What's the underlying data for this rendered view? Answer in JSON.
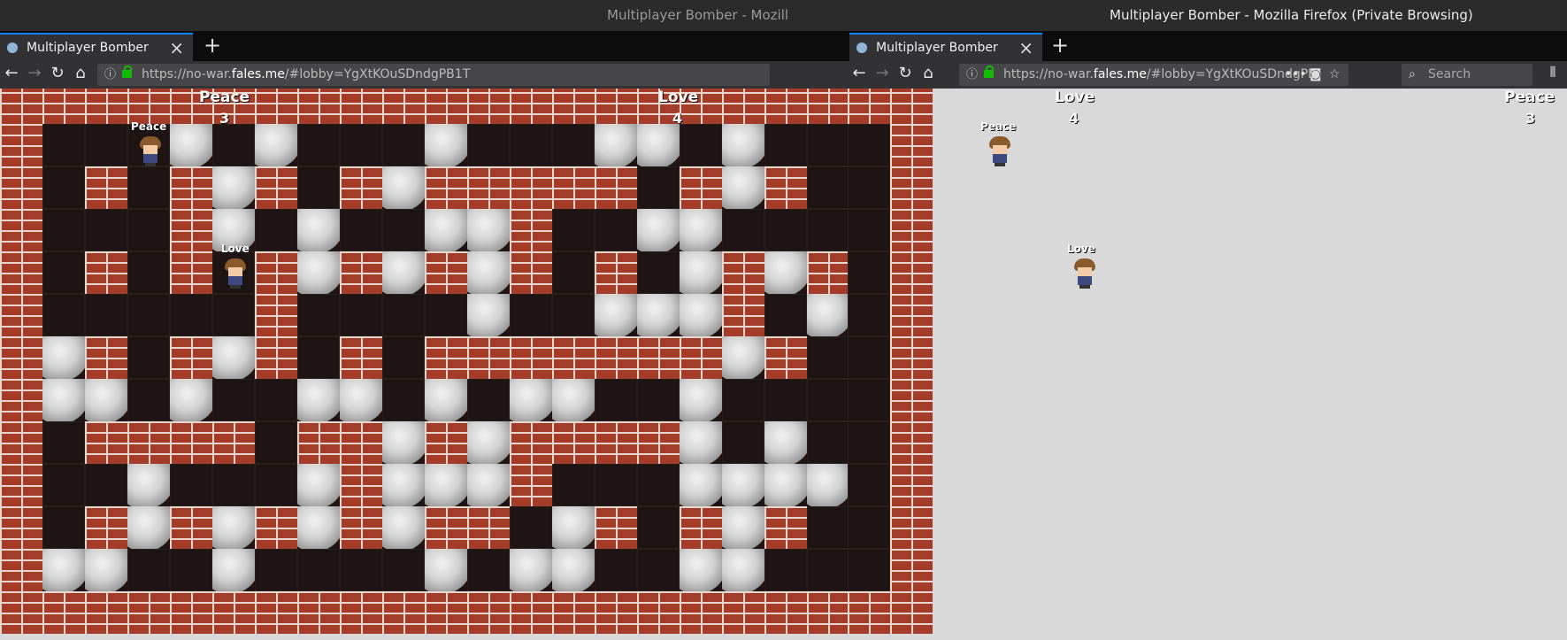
{
  "windows": [
    {
      "id": "left",
      "title": "Multiplayer Bomber - Mozill",
      "tab_label": "Multiplayer Bomber",
      "url_prefix": "https://no-war.",
      "url_host": "fales.me",
      "url_suffix": "/#lobby=YgXtKOuSDndgPB1T",
      "hud": [
        {
          "name": "Peace",
          "score": "3"
        },
        {
          "name": "Love",
          "score": "4"
        }
      ],
      "players": [
        {
          "label": "Peace"
        },
        {
          "label": "Love"
        }
      ]
    },
    {
      "id": "right",
      "title": "Multiplayer Bomber - Mozilla Firefox (Private Browsing)",
      "tab_label": "Multiplayer Bomber",
      "url_prefix": "https://no-war.",
      "url_host": "fales.me",
      "url_suffix": "/#lobby=YgXtKOuSDndgPB",
      "search_placeholder": "Search",
      "hud": [
        {
          "name": "Love",
          "score": "4"
        },
        {
          "name": "Peace",
          "score": "3"
        }
      ],
      "players": [
        {
          "label": "Peace"
        },
        {
          "label": "Love"
        }
      ]
    }
  ],
  "game_board": {
    "legend": {
      "B": "brick-wall",
      "S": "stone-block",
      ".": "floor"
    },
    "rows": [
      "BBBBBBBBBBBBBBBBBBBBBB",
      "BBBBBBBBBBBBBBBBBBBBBB",
      "B...S.S...S...SS.S...B",
      "B.B.BSB.BSBBBBB.BSB..B",
      "B...BS.S..SSB..SS....B",
      "B.B.B.BSBSBSB.B.SBSB.B",
      "B.....B....S..SSSB.S.B",
      "BSB.BSB.B.BBBBBBBSB..B",
      "BSS.S..SS.S.SS..S....B",
      "B.BBBB.BBSBSBBBBS.S..B",
      "B..S...SBSSSB...SSSS.B",
      "B.BSBSBSBSBB.SB.BSB..B",
      "BSS..S....S.SS..SS...B",
      "BBBBBBBBBBBBBBBBBBBBBB"
    ]
  },
  "colors": {
    "brick": "#a33c28",
    "mortar": "#e9d6cf",
    "floor": "#1e1413",
    "stone": "#d2d2d2",
    "tab_accent": "#0a84ff",
    "lock": "#12bc00"
  }
}
